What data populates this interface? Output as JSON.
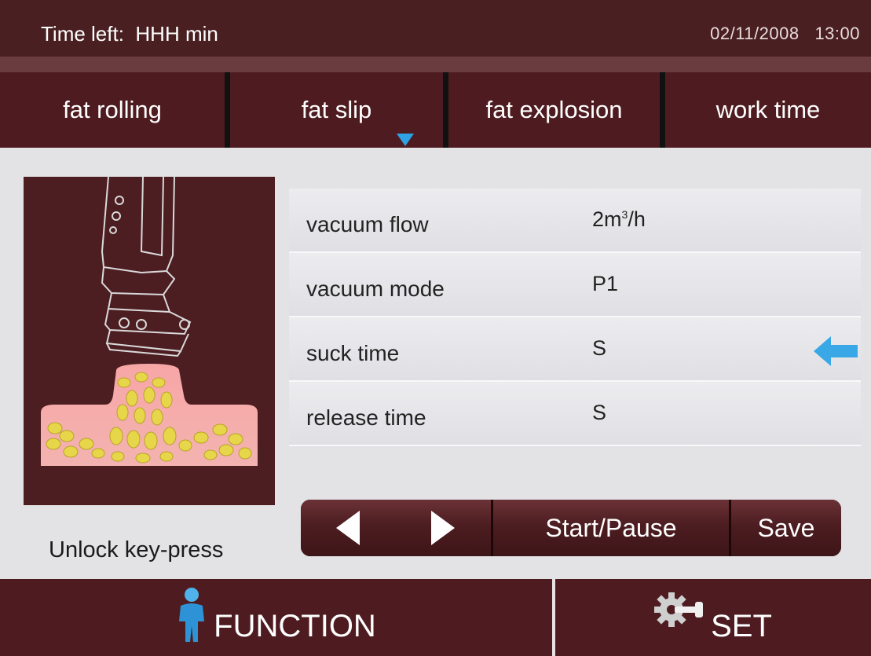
{
  "status": {
    "time_left": "Time left:  HHH min",
    "date": "02/11/2008",
    "time": "13:00"
  },
  "tabs": [
    {
      "label": "fat rolling",
      "active": false
    },
    {
      "label": "fat slip",
      "active": true
    },
    {
      "label": "fat explosion",
      "active": false
    },
    {
      "label": "work time",
      "active": false
    }
  ],
  "settings": [
    {
      "label": "vacuum flow",
      "value": "2m",
      "value_sup": "3",
      "value_tail": "/h",
      "selected": false
    },
    {
      "label": "vacuum mode",
      "value": "P1",
      "selected": false
    },
    {
      "label": "suck time",
      "value": "S",
      "selected": true
    },
    {
      "label": "release time",
      "value": "S",
      "selected": false
    }
  ],
  "unlock_label": "Unlock key-press",
  "controls": {
    "prev_icon": "triangle-left-icon",
    "next_icon": "triangle-right-icon",
    "start_pause_label": "Start/Pause",
    "save_label": "Save"
  },
  "bottom": {
    "function_label": "FUNCTION",
    "function_icon": "person-icon",
    "set_label": "SET",
    "set_icon": "gear-wrench-icon"
  },
  "colors": {
    "bar": "#4e1c20",
    "accent": "#2ea2e4",
    "panel": "#e3e3e6"
  }
}
